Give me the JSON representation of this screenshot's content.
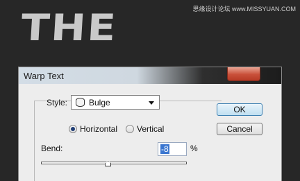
{
  "canvas": {
    "text": "THE"
  },
  "watermark": {
    "text": "思缘设计论坛 www.MISSYUAN.COM"
  },
  "dialog": {
    "title": "Warp Text",
    "style": {
      "label": "Style:",
      "value": "Bulge",
      "icon": "bulge-warp-icon"
    },
    "orientation": {
      "options": [
        "Horizontal",
        "Vertical"
      ],
      "selected": "Horizontal"
    },
    "bend": {
      "label": "Bend:",
      "value": "-8",
      "unit": "%",
      "slider_percent": -8
    },
    "buttons": {
      "ok": "OK",
      "cancel": "Cancel"
    }
  }
}
